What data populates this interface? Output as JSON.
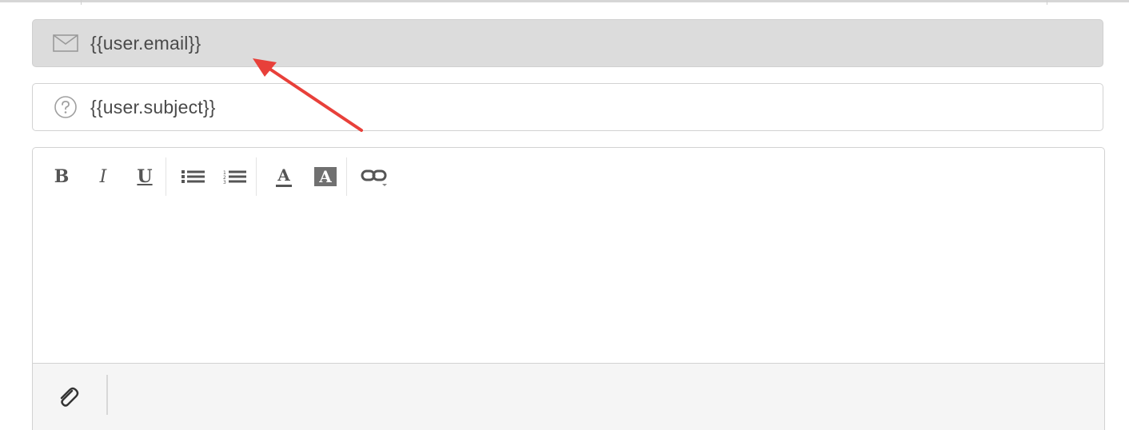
{
  "recipient": {
    "value": "{{user.email}}",
    "icon": "envelope-icon"
  },
  "subject": {
    "value": "{{user.subject}}",
    "icon": "question-circle-icon"
  },
  "toolbar": {
    "bold": "B",
    "italic": "I",
    "underline": "U",
    "unordered_list_icon": "bullet-list-icon",
    "ordered_list_icon": "numbered-list-icon",
    "font_color": "A",
    "highlight": "A",
    "link_icon": "link-icon"
  },
  "body": {
    "text": ""
  },
  "footer": {
    "attach_icon": "paperclip-icon"
  },
  "annotation": {
    "color": "#e8403a"
  }
}
